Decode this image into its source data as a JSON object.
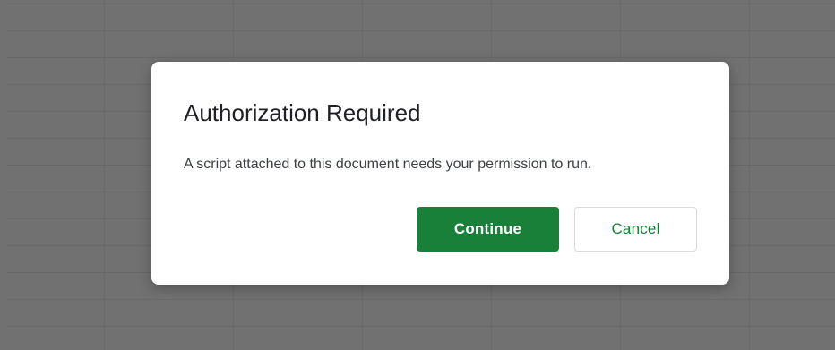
{
  "dialog": {
    "title": "Authorization Required",
    "message": "A script attached to this document needs your permission to run.",
    "primary_button": "Continue",
    "secondary_button": "Cancel"
  },
  "colors": {
    "accent": "#188038",
    "scrim": "#5a5a5a",
    "dialog_background": "#ffffff"
  }
}
